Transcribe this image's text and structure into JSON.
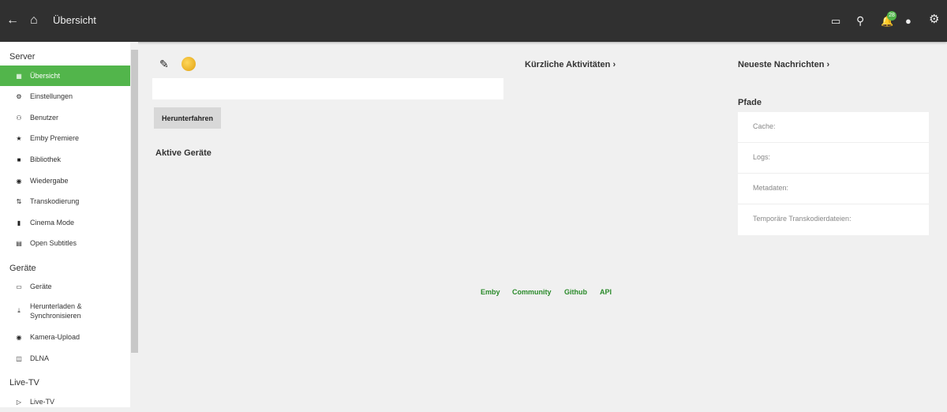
{
  "header": {
    "title": "Übersicht",
    "notification_count": "28",
    "icons": [
      "back-arrow-icon",
      "home-icon",
      "cast-icon",
      "search-icon",
      "bell-icon",
      "user-icon",
      "gear-icon"
    ]
  },
  "sidebar": {
    "sections": [
      {
        "title": "Server",
        "items": [
          {
            "label": "Übersicht",
            "active": true
          },
          {
            "label": "Einstellungen"
          },
          {
            "label": "Benutzer"
          },
          {
            "label": "Emby Premiere"
          },
          {
            "label": "Bibliothek"
          },
          {
            "label": "Wiedergabe"
          },
          {
            "label": "Transkodierung"
          },
          {
            "label": "Cinema Mode"
          },
          {
            "label": "Open Subtitles"
          }
        ]
      },
      {
        "title": "Geräte",
        "items": [
          {
            "label": "Geräte"
          },
          {
            "label": "Herunterladen & Synchronisieren"
          },
          {
            "label": "Kamera-Upload"
          },
          {
            "label": "DLNA"
          }
        ]
      },
      {
        "title": "Live-TV",
        "items": [
          {
            "label": "Live-TV"
          }
        ]
      }
    ]
  },
  "main": {
    "shutdown_label": "Herunterfahren",
    "active_devices": "Aktive Geräte",
    "recent_activity": "Kürzliche Aktivitäten",
    "news": "Neueste Nachrichten",
    "paths_title": "Pfade",
    "paths": [
      "Cache:",
      "Logs:",
      "Metadaten:",
      "Temporäre Transkodierdateien:"
    ]
  },
  "footer": {
    "links": [
      "Emby",
      "Community",
      "Github",
      "API"
    ]
  },
  "colors": {
    "accent": "#52b54b",
    "header": "#303030",
    "link": "#2a8a2a"
  }
}
